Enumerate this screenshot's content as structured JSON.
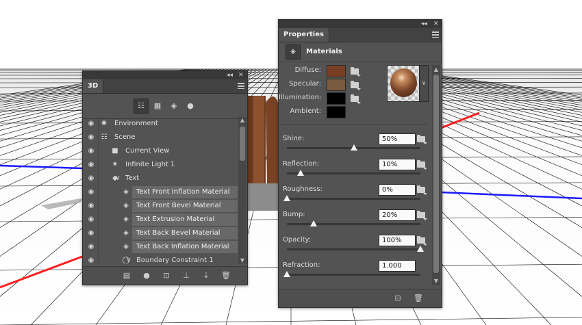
{
  "panel3d": {
    "tab": "3D",
    "filter_icons": [
      "scene-filter-icon",
      "mesh-filter-icon",
      "material-filter-icon",
      "light-filter-icon"
    ],
    "rows": [
      {
        "label": "Environment",
        "icon": "environment-icon",
        "indent": 0,
        "expander": "",
        "highlight": false
      },
      {
        "label": "Scene",
        "icon": "scene-icon",
        "indent": 0,
        "expander": "",
        "highlight": false
      },
      {
        "label": "Current View",
        "icon": "camera-icon",
        "indent": 1,
        "expander": "",
        "highlight": false
      },
      {
        "label": "Infinite Light 1",
        "icon": "sun-icon",
        "indent": 1,
        "expander": "",
        "highlight": false
      },
      {
        "label": "Text",
        "icon": "mesh-icon",
        "indent": 1,
        "expander": "∨",
        "highlight": false
      },
      {
        "label": "Text Front Inflation Material",
        "icon": "material-icon",
        "indent": 2,
        "expander": "",
        "highlight": true
      },
      {
        "label": "Text Front Bevel Material",
        "icon": "material-icon",
        "indent": 2,
        "expander": "",
        "highlight": true
      },
      {
        "label": "Text Extrusion Material",
        "icon": "material-icon",
        "indent": 2,
        "expander": "",
        "highlight": true
      },
      {
        "label": "Text Back Bevel Material",
        "icon": "material-icon",
        "indent": 2,
        "expander": "",
        "highlight": true
      },
      {
        "label": "Text Back Inflation Material",
        "icon": "material-icon",
        "indent": 2,
        "expander": "",
        "highlight": true
      },
      {
        "label": "Boundary Constraint 1",
        "icon": "constraint-icon",
        "indent": 2,
        "expander": "∨",
        "highlight": false
      }
    ],
    "bottom_icons": [
      "new-mesh-icon",
      "new-light-icon",
      "add-material-icon",
      "drop-to-ground-icon",
      "render-icon",
      "delete-icon"
    ]
  },
  "props": {
    "tab": "Properties",
    "section": "Materials",
    "colors": [
      {
        "label": "Diffuse:",
        "color": "#7a3f23"
      },
      {
        "label": "Specular:",
        "color": "#7a5a3c"
      },
      {
        "label": "Illumination:",
        "color": "#000000"
      },
      {
        "label": "Ambient:",
        "color": "#000000"
      }
    ],
    "sliders": [
      {
        "label": "Shine:",
        "value": "50%",
        "level": 0.5,
        "folder": true
      },
      {
        "label": "Reflection:",
        "value": "10%",
        "level": 0.1,
        "folder": true
      },
      {
        "label": "Roughness:",
        "value": "0%",
        "level": 0.0,
        "folder": true
      },
      {
        "label": "Bump:",
        "value": "20%",
        "level": 0.2,
        "folder": true
      },
      {
        "label": "Opacity:",
        "value": "100%",
        "level": 1.0,
        "folder": true
      },
      {
        "label": "Refraction:",
        "value": "1.000",
        "level": 0.0,
        "folder": false
      }
    ]
  },
  "colors": {
    "panel": "#535353",
    "titlebar": "#383838",
    "axis_x": "#ff1f1f",
    "axis_y": "#1a1aff",
    "grid": "#000000"
  }
}
